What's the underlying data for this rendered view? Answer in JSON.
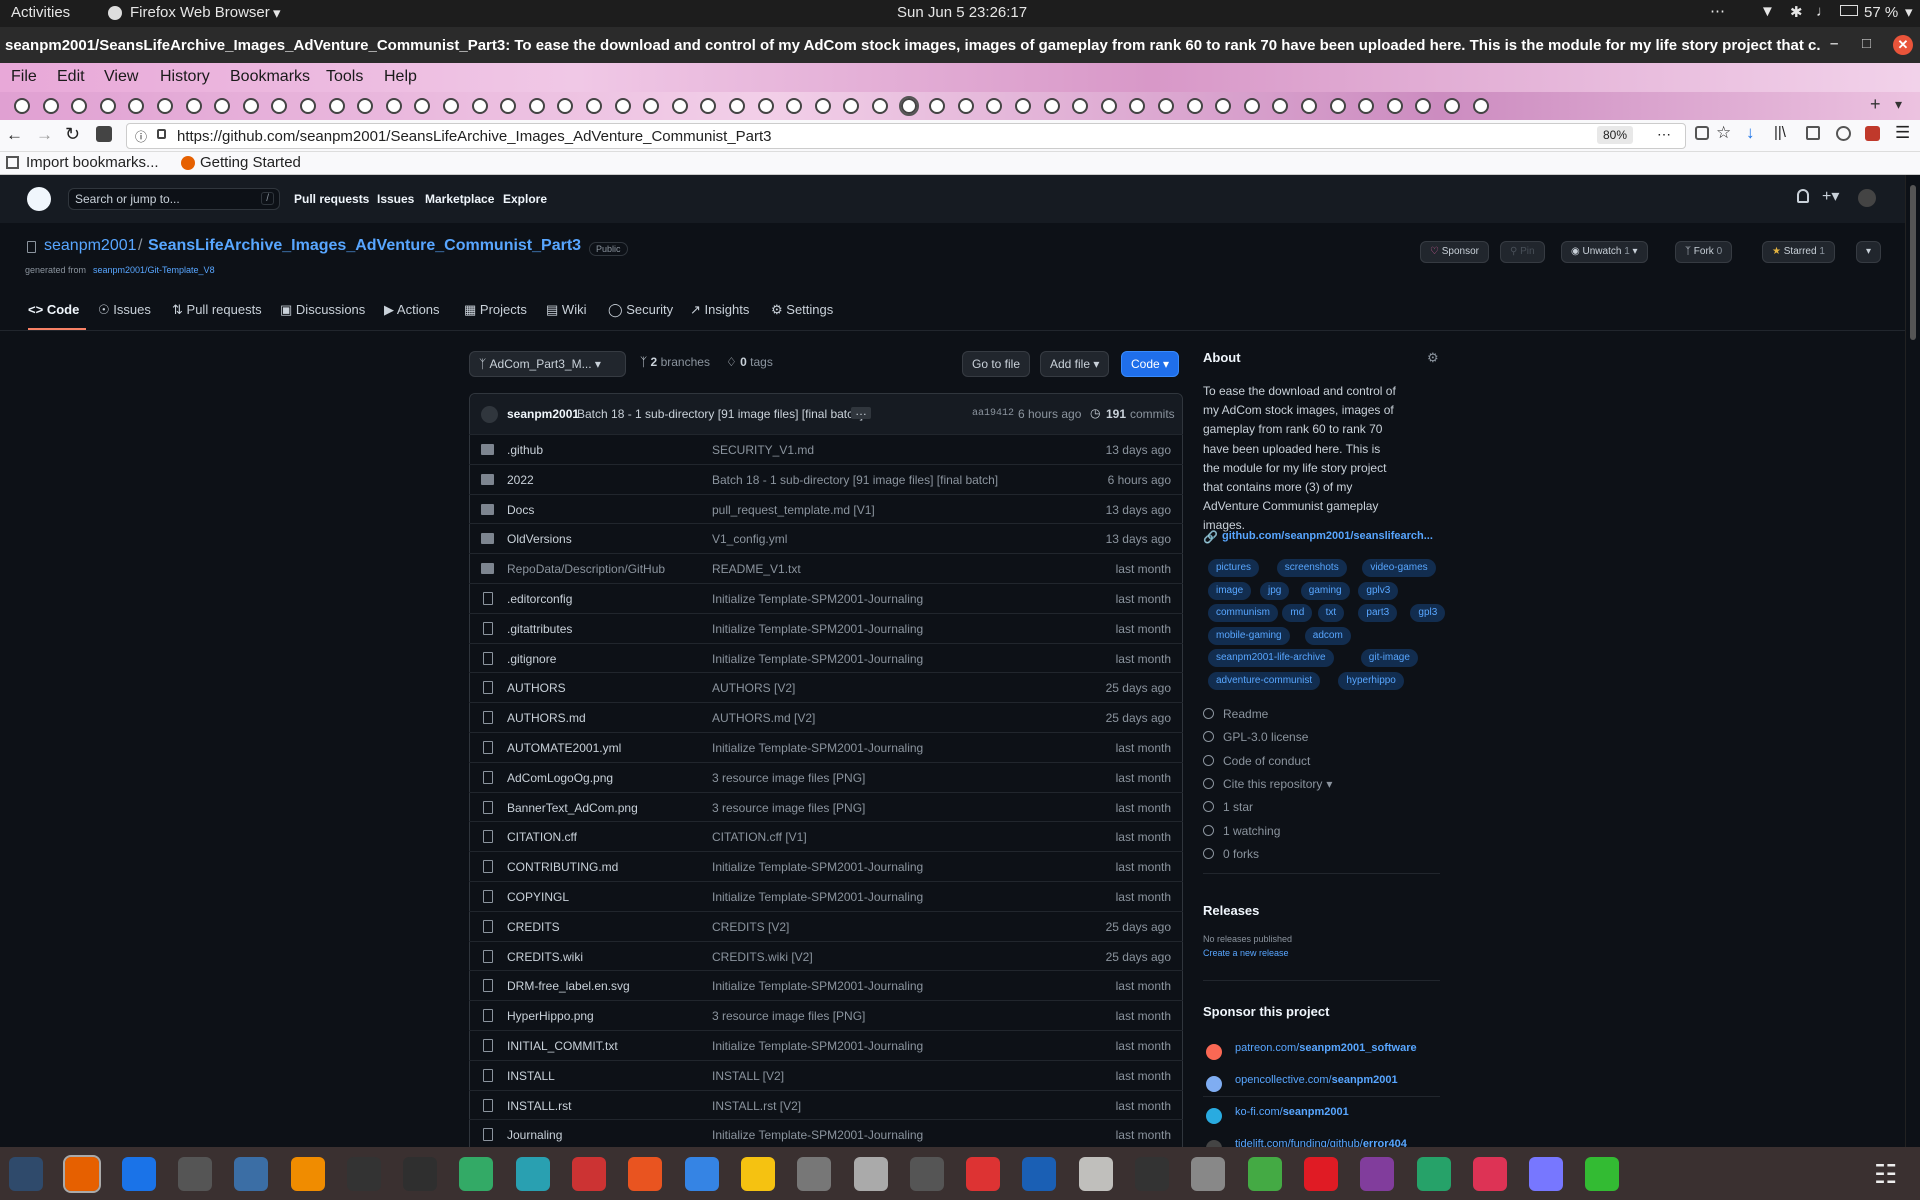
{
  "system_bar": {
    "activities": "Activities",
    "app": "Firefox Web Browser",
    "clock": "Sun Jun 5  23:26:17",
    "battery": "57 %"
  },
  "window": {
    "title": "seanpm2001/SeansLifeArchive_Images_AdVenture_Communist_Part3: To ease the download and control of my AdCom stock images, images of gameplay from rank 60 to rank 70 have been uploaded here. This is the module for my life story project that c..."
  },
  "menu": [
    "File",
    "Edit",
    "View",
    "History",
    "Bookmarks",
    "Tools",
    "Help"
  ],
  "navbar": {
    "url": "https://github.com/seanpm2001/SeansLifeArchive_Images_AdVenture_Communist_Part3",
    "zoom": "80%"
  },
  "bookmarks": [
    "Import bookmarks...",
    "Getting Started"
  ],
  "gh_header": {
    "search_placeholder": "Search or jump to...",
    "search_key": "/",
    "nav": [
      "Pull requests",
      "Issues",
      "Marketplace",
      "Explore"
    ]
  },
  "repo": {
    "owner": "seanpm2001",
    "sep": "/",
    "name": "SeansLifeArchive_Images_AdVenture_Communist_Part3",
    "visibility": "Public",
    "generated_prefix": "generated from ",
    "generated_link": "seanpm2001/Git-Template_V8",
    "actions": {
      "sponsor": "Sponsor",
      "pin": "Pin",
      "unwatch": "Unwatch",
      "unwatch_count": "1",
      "fork": "Fork",
      "fork_count": "0",
      "starred": "Starred",
      "star_count": "1"
    },
    "tabs": [
      "Code",
      "Issues",
      "Pull requests",
      "Discussions",
      "Actions",
      "Projects",
      "Wiki",
      "Security",
      "Insights",
      "Settings"
    ]
  },
  "toolbar": {
    "branch": "AdCom_Part3_M...",
    "branches_count": "2",
    "branches_label": "branches",
    "tags_count": "0",
    "tags_label": "tags",
    "go_to_file": "Go to file",
    "add_file": "Add file",
    "code": "Code"
  },
  "commit": {
    "author": "seanpm2001",
    "message": "Batch 18 - 1 sub-directory [91 image files] [final batch]",
    "ellipsis": "…",
    "hash": "aa19412",
    "time": "6 hours ago",
    "count": "191",
    "count_label": "commits"
  },
  "files": [
    {
      "type": "dir",
      "name": ".github",
      "msg": "SECURITY_V1.md",
      "time": "13 days ago"
    },
    {
      "type": "dir",
      "name": "2022",
      "msg": "Batch 18 - 1 sub-directory [91 image files] [final batch]",
      "time": "6 hours ago"
    },
    {
      "type": "dir",
      "name": "Docs",
      "msg": "pull_request_template.md [V1]",
      "time": "13 days ago"
    },
    {
      "type": "dir",
      "name": "OldVersions",
      "msg": "V1_config.yml",
      "time": "13 days ago"
    },
    {
      "type": "dir",
      "name": "RepoData/Description/GitHub",
      "msg": "README_V1.txt",
      "time": "last month"
    },
    {
      "type": "file",
      "name": ".editorconfig",
      "msg": "Initialize Template-SPM2001-Journaling",
      "time": "last month"
    },
    {
      "type": "file",
      "name": ".gitattributes",
      "msg": "Initialize Template-SPM2001-Journaling",
      "time": "last month"
    },
    {
      "type": "file",
      "name": ".gitignore",
      "msg": "Initialize Template-SPM2001-Journaling",
      "time": "last month"
    },
    {
      "type": "file",
      "name": "AUTHORS",
      "msg": "AUTHORS [V2]",
      "time": "25 days ago"
    },
    {
      "type": "file",
      "name": "AUTHORS.md",
      "msg": "AUTHORS.md [V2]",
      "time": "25 days ago"
    },
    {
      "type": "file",
      "name": "AUTOMATE2001.yml",
      "msg": "Initialize Template-SPM2001-Journaling",
      "time": "last month"
    },
    {
      "type": "file",
      "name": "AdComLogoOg.png",
      "msg": "3 resource image files [PNG]",
      "time": "last month"
    },
    {
      "type": "file",
      "name": "BannerText_AdCom.png",
      "msg": "3 resource image files [PNG]",
      "time": "last month"
    },
    {
      "type": "file",
      "name": "CITATION.cff",
      "msg": "CITATION.cff [V1]",
      "time": "last month"
    },
    {
      "type": "file",
      "name": "CONTRIBUTING.md",
      "msg": "Initialize Template-SPM2001-Journaling",
      "time": "last month"
    },
    {
      "type": "file",
      "name": "COPYINGL",
      "msg": "Initialize Template-SPM2001-Journaling",
      "time": "last month"
    },
    {
      "type": "file",
      "name": "CREDITS",
      "msg": "CREDITS [V2]",
      "time": "25 days ago"
    },
    {
      "type": "file",
      "name": "CREDITS.wiki",
      "msg": "CREDITS.wiki [V2]",
      "time": "25 days ago"
    },
    {
      "type": "file",
      "name": "DRM-free_label.en.svg",
      "msg": "Initialize Template-SPM2001-Journaling",
      "time": "last month"
    },
    {
      "type": "file",
      "name": "HyperHippo.png",
      "msg": "3 resource image files [PNG]",
      "time": "last month"
    },
    {
      "type": "file",
      "name": "INITIAL_COMMIT.txt",
      "msg": "Initialize Template-SPM2001-Journaling",
      "time": "last month"
    },
    {
      "type": "file",
      "name": "INSTALL",
      "msg": "INSTALL [V2]",
      "time": "last month"
    },
    {
      "type": "file",
      "name": "INSTALL.rst",
      "msg": "INSTALL.rst [V2]",
      "time": "last month"
    },
    {
      "type": "file",
      "name": "Journaling",
      "msg": "Initialize Template-SPM2001-Journaling",
      "time": "last month"
    }
  ],
  "about": {
    "heading": "About",
    "description": "To ease the download and control of my AdCom stock images, images of gameplay from rank 60 to rank 70 have been uploaded here. This is the module for my life story project that contains more (3) of my AdVenture Communist gameplay images.",
    "link": "github.com/seanpm2001/seanslifearch...",
    "topics": [
      "pictures",
      "screenshots",
      "video-games",
      "image",
      "jpg",
      "gaming",
      "gplv3",
      "communism",
      "md",
      "txt",
      "part3",
      "gpl3",
      "mobile-gaming",
      "adcom",
      "seanpm2001-life-archive",
      "git-image",
      "adventure-communist",
      "hyperhippo"
    ],
    "items": [
      "Readme",
      "GPL-3.0 license",
      "Code of conduct",
      "Cite this repository",
      "1 star",
      "1 watching",
      "0 forks"
    ]
  },
  "releases": {
    "heading": "Releases",
    "none": "No releases published",
    "create": "Create a new release"
  },
  "sponsor": {
    "heading": "Sponsor this project",
    "links": [
      {
        "pre": "patreon.com/",
        "bold": "seanpm2001_software"
      },
      {
        "pre": "opencollective.com/",
        "bold": "seanpm2001"
      },
      {
        "pre": "ko-fi.com/",
        "bold": "seanpm2001"
      },
      {
        "pre": "tidelift.com/funding/github/",
        "bold": "error404"
      }
    ]
  },
  "colors": {
    "accent": "#58a6ff",
    "primary_button": "#238636",
    "code_button": "#1f6feb",
    "tab_underline": "#f78166"
  }
}
